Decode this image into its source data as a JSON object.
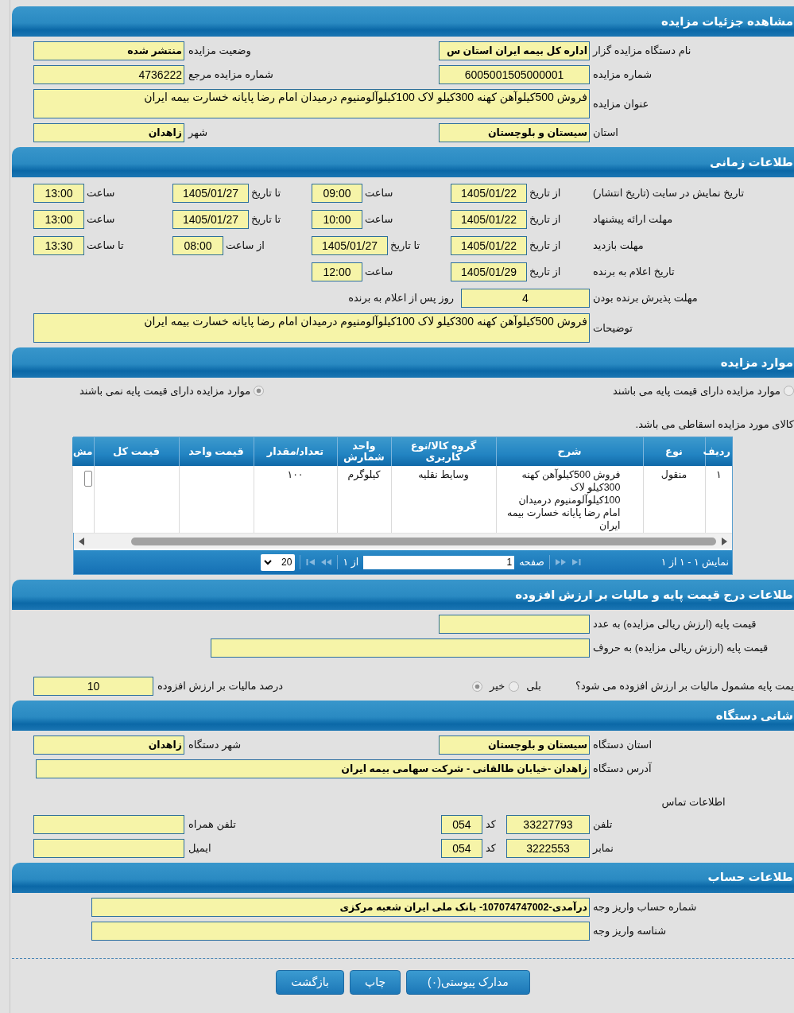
{
  "sections": [
    {
      "title": "مشاهده جزئیات مزایده",
      "rows": [
        {
          "kind": "pairs",
          "items": [
            {
              "label": "نام دستگاه مزایده گزار",
              "field": {
                "kind": "choice",
                "value": "اداره کل بیمه ایران استان س"
              }
            },
            {
              "label": "وضعیت مزایده",
              "field": {
                "kind": "choice",
                "value": "منتشر شده"
              }
            }
          ]
        },
        {
          "kind": "pairs",
          "items": [
            {
              "label": "شماره مزایده",
              "field": {
                "kind": "number",
                "value": "6005001505000001"
              }
            },
            {
              "label": "شماره مزایده مرجع",
              "field": {
                "kind": "text",
                "value": "4736222"
              }
            }
          ]
        },
        {
          "kind": "pairs",
          "items": [
            {
              "label": "عنوان مزایده",
              "field": {
                "kind": "memo",
                "value": "فروش 500کیلوآهن کهنه 300کیلو لاک 100کیلوآلومنیوم درمیدان امام رضا پایانه خسارت بیمه ایران"
              }
            }
          ]
        },
        {
          "kind": "pairs",
          "items": [
            {
              "label": "استان",
              "field": {
                "kind": "choice",
                "value": "سیستان و بلوچستان"
              }
            },
            {
              "label": "شهر",
              "field": {
                "kind": "choice",
                "value": "زاهدان"
              }
            }
          ]
        }
      ]
    },
    {
      "title": "طلاعات زمانی",
      "rows": [
        {
          "kind": "schedule",
          "label": "تاریخ نمایش در سایت (تاریخ انتشار)",
          "cells": [
            {
              "label": "از تاریخ",
              "field": {
                "kind": "date",
                "value": "1405/01/22"
              }
            },
            {
              "label": "ساعت",
              "field": {
                "kind": "time",
                "value": "09:00"
              }
            },
            {
              "label": "تا تاریخ",
              "field": {
                "kind": "date",
                "value": "1405/01/27"
              }
            },
            {
              "label": "ساعت",
              "field": {
                "kind": "time",
                "value": "13:00"
              }
            }
          ]
        },
        {
          "kind": "schedule",
          "label": "مهلت ارائه پیشنهاد",
          "cells": [
            {
              "label": "از تاریخ",
              "field": {
                "kind": "date",
                "value": "1405/01/22"
              }
            },
            {
              "label": "ساعت",
              "field": {
                "kind": "time",
                "value": "10:00"
              }
            },
            {
              "label": "تا تاریخ",
              "field": {
                "kind": "date",
                "value": "1405/01/27"
              }
            },
            {
              "label": "ساعت",
              "field": {
                "kind": "time",
                "value": "13:00"
              }
            }
          ]
        },
        {
          "kind": "schedule",
          "label": "مهلت بازدید",
          "cells": [
            {
              "label": "از تاریخ",
              "field": {
                "kind": "date",
                "value": "1405/01/22"
              }
            },
            {
              "label": "تا تاریخ",
              "field": {
                "kind": "date",
                "value": "1405/01/27"
              }
            },
            {
              "label": "از ساعت",
              "field": {
                "kind": "time",
                "value": "08:00"
              }
            },
            {
              "label": "تا ساعت",
              "field": {
                "kind": "time",
                "value": "13:30"
              }
            }
          ]
        },
        {
          "kind": "schedule",
          "label": "تاریخ اعلام به برنده",
          "cells": [
            {
              "label": "از تاریخ",
              "field": {
                "kind": "date",
                "value": "1405/01/29"
              }
            },
            {
              "label": "ساعت",
              "field": {
                "kind": "time",
                "value": "12:00"
              }
            }
          ]
        },
        {
          "kind": "schedule",
          "label": "مهلت پذیرش برنده بودن",
          "cells": [
            {
              "field": {
                "kind": "count",
                "value": "4"
              },
              "suffix": "روز پس از اعلام به برنده"
            }
          ]
        },
        {
          "kind": "pairs",
          "items": [
            {
              "label": "توضیحات",
              "field": {
                "kind": "memo",
                "value": "فروش 500کیلوآهن کهنه 300کیلو لاک 100کیلوآلومنیوم درمیدان امام رضا پایانه خسارت بیمه ایران"
              }
            }
          ]
        }
      ]
    },
    {
      "title": "موارد مزایده",
      "rows": [
        {
          "kind": "options",
          "options": [
            {
              "label": "موارد مزایده دارای قیمت پایه می باشند",
              "selected": false
            },
            {
              "label": "موارد مزایده دارای قیمت پایه نمی باشند",
              "selected": true
            }
          ]
        },
        {
          "kind": "note",
          "text": "کالای مورد مزایده اسقاطی می باشد."
        },
        {
          "kind": "table",
          "columns": [
            "ردیف",
            "نوع",
            "شرح",
            "گروه کالا/نوع کاربری",
            "واحد شمارش",
            "تعداد/مقدار",
            "قیمت واحد",
            "قیمت کل",
            "مش"
          ],
          "rows": [
            {
              "cells": [
                {
                  "kind": "text",
                  "text": "۱"
                },
                {
                  "kind": "text",
                  "text": "منقول"
                },
                {
                  "kind": "text",
                  "text": "فروش 500کیلوآهن کهنه 300کیلو لاک 100کیلوآلومنیوم درمیدان امام رضا پایانه خسارت بیمه ایران"
                },
                {
                  "kind": "text",
                  "text": "وسایط نقلیه"
                },
                {
                  "kind": "text",
                  "text": "کیلوگرم"
                },
                {
                  "kind": "text",
                  "text": "۱۰۰"
                },
                {
                  "kind": "text"
                },
                {
                  "kind": "text"
                },
                {
                  "kind": "button"
                }
              ]
            }
          ],
          "pager": {
            "summary": "نمایش ۱ - ۱ از ۱",
            "page_label": "صفحه",
            "page": "1",
            "total": "از ۱",
            "page_size": "20"
          }
        }
      ]
    },
    {
      "title": "طلاعات درج قیمت پایه و مالیات بر ارزش افزوده",
      "rows": [
        {
          "kind": "pairs",
          "items": [
            {
              "label": "قیمت پایه (ارزش ریالی مزایده) به عدد",
              "field": {
                "kind": "text"
              }
            }
          ]
        },
        {
          "kind": "pairs",
          "items": [
            {
              "label": "قیمت پایه (ارزش ریالی مزایده) به حروف",
              "field": {
                "kind": "words"
              }
            }
          ]
        },
        {
          "kind": "pairs",
          "items": [
            {
              "label": "یمت پایه مشمول مالیات بر ارزش افزوده می شود؟",
              "field": {
                "kind": "radios",
                "options": [
                  {
                    "label": "بلی",
                    "selected": false
                  },
                  {
                    "label": "خیر",
                    "selected": true
                  }
                ]
              }
            },
            {
              "label": "درصد مالیات بر ارزش افزوده",
              "field": {
                "kind": "percent",
                "value": "10"
              }
            }
          ]
        }
      ]
    },
    {
      "title": "شانی دستگاه",
      "rows": [
        {
          "kind": "pairs",
          "items": [
            {
              "label": "استان دستگاه",
              "field": {
                "kind": "choice",
                "value": "سیستان و بلوچستان"
              }
            },
            {
              "label": "شهر دستگاه",
              "field": {
                "kind": "choice",
                "value": "زاهدان"
              }
            }
          ]
        },
        {
          "kind": "pairs",
          "items": [
            {
              "label": "آدرس دستگاه",
              "field": {
                "kind": "address",
                "value": "زاهدان -خیابان طالقانی - شرکت سهامی بیمه ایران"
              }
            }
          ]
        },
        {
          "kind": "heading",
          "text": "اطلاعات تماس"
        },
        {
          "kind": "pairs",
          "items": [
            {
              "label": "تلفن",
              "field": {
                "kind": "phone",
                "value": "33227793"
              },
              "extra": {
                "label": "کد",
                "field": {
                  "kind": "code",
                  "value": "054"
                }
              }
            },
            {
              "label": "تلفن همراه",
              "field": {
                "kind": "text"
              }
            }
          ]
        },
        {
          "kind": "pairs",
          "items": [
            {
              "label": "نمابر",
              "field": {
                "kind": "phone",
                "value": "3222553"
              },
              "extra": {
                "label": "کد",
                "field": {
                  "kind": "code",
                  "value": "054"
                }
              }
            },
            {
              "label": "ایمیل",
              "field": {
                "kind": "text"
              }
            }
          ]
        }
      ]
    },
    {
      "title": "طلاعات حساب",
      "rows": [
        {
          "kind": "pairs",
          "items": [
            {
              "label": "شماره حساب واریز وجه",
              "field": {
                "kind": "account",
                "value": "درآمدی-107074747002- بانک ملی ایران شعبه مرکزی"
              }
            }
          ]
        },
        {
          "kind": "pairs",
          "items": [
            {
              "label": "شناسه واریز وجه",
              "field": {
                "kind": "account"
              }
            }
          ]
        }
      ]
    }
  ],
  "buttons": [
    "مدارک پیوستی(۰)",
    "چاپ",
    "بازگشت"
  ]
}
